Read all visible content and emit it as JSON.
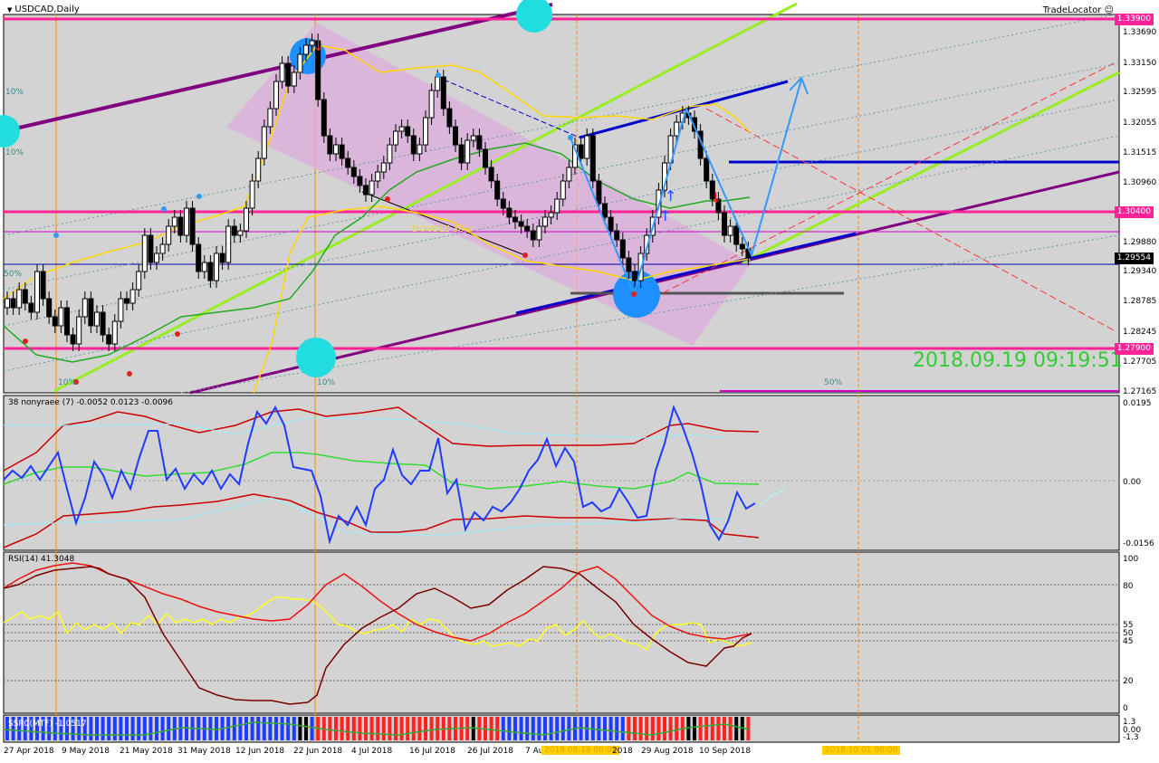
{
  "header": {
    "symbol_title": "USDCAD,Daily",
    "tradelocator": "TradeLocator"
  },
  "price_axis": {
    "labels": [
      "1.33690",
      "1.33150",
      "1.32595",
      "1.32055",
      "1.31515",
      "1.30960",
      "1.29880",
      "1.29340",
      "1.28785",
      "1.28245",
      "1.27705",
      "1.27165"
    ],
    "boxes": [
      {
        "text": "1.33900",
        "color": "#ff2299"
      },
      {
        "text": "1.30400",
        "color": "#ff2299"
      },
      {
        "text": "1.29554",
        "color": "#000000"
      },
      {
        "text": "1.27900",
        "color": "#ff2299"
      }
    ]
  },
  "overlay_text": {
    "timestamp": "2018.09.19 09:19:51",
    "mid_label": "DOUBLE 30%",
    "pct_labels": [
      "10%",
      "10%",
      "50%",
      "10%",
      "50%",
      "10%"
    ]
  },
  "oscillator": {
    "title": "38 nonyraee (7) -0.0052 0.0123 -0.0096",
    "axis": [
      "0.0195",
      "0.00",
      "-0.0156"
    ]
  },
  "rsi": {
    "title": "RSI(14) 41.3048",
    "axis": [
      "100",
      "80",
      "55",
      "50",
      "45",
      "20",
      "0"
    ]
  },
  "ssrc": {
    "title": "SSRC(MTF) -1.0517",
    "axis": [
      "1.3",
      "0.00",
      "-1.3"
    ]
  },
  "time_axis": {
    "labels": [
      "27 Apr 2018",
      "9 May 2018",
      "21 May 2018",
      "31 May 2018",
      "12 Jun 2018",
      "22 Jun 2018",
      "4 Jul 2018",
      "16 Jul 2018",
      "26 Jul 2018",
      "7 Aug",
      "29 Aug 2018",
      "10 Sep 2018"
    ],
    "highlight_1": "2018.08.18 00:00",
    "highlight_2": "2018.10.01 00:00",
    "stub": "2018"
  },
  "colors": {
    "chart_bg": "#d3d3d3",
    "hline": "#ff2299",
    "channel": "#ddaadd",
    "bull": "#ffffff",
    "bear": "#000000"
  }
}
